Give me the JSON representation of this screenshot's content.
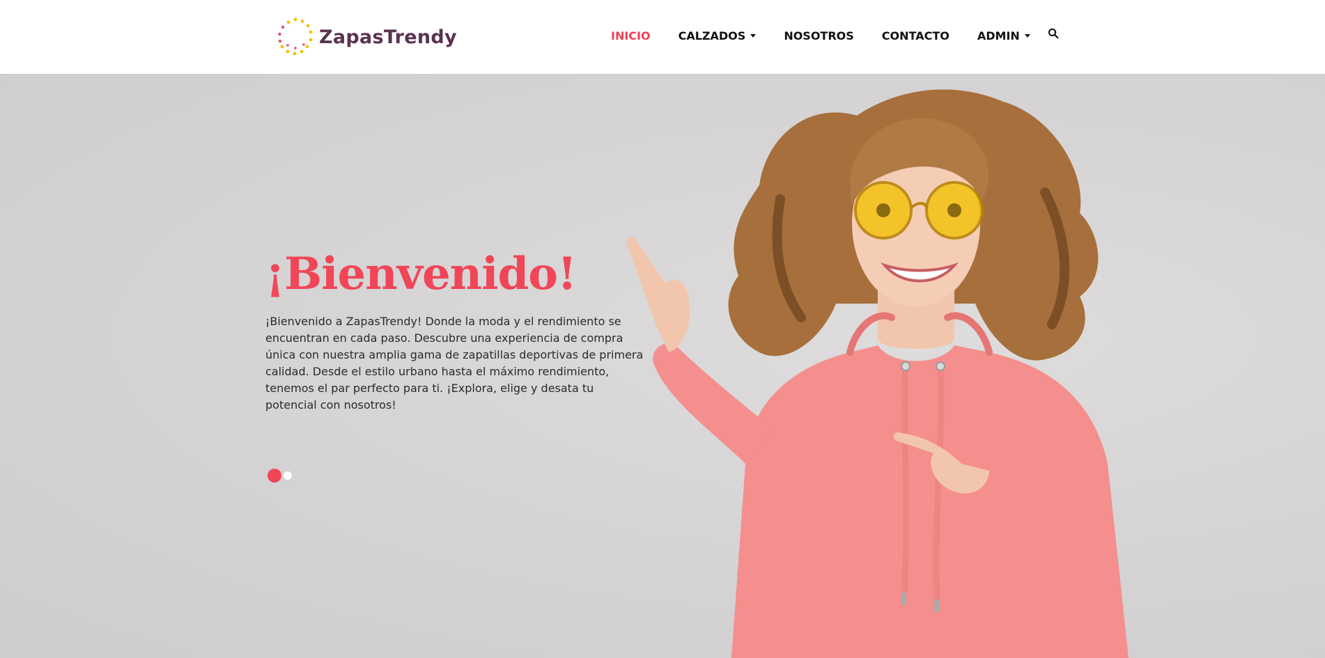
{
  "brand": {
    "name": "ZapasTrendy",
    "colors": {
      "accent": "#f04658",
      "logo_text": "#5a3350",
      "logo_dots": "#f4c20d"
    }
  },
  "nav": {
    "items": [
      {
        "label": "INICIO",
        "active": true
      },
      {
        "label": "CALZADOS",
        "dropdown": true
      },
      {
        "label": "NOSOTROS"
      },
      {
        "label": "CONTACTO"
      },
      {
        "label": "ADMIN",
        "dropdown": true
      }
    ],
    "search_icon": "search-icon"
  },
  "hero": {
    "title": "¡Bienvenido!",
    "text": "¡Bienvenido a ZapasTrendy! Donde la moda y el rendimiento se encuentran en cada paso. Descubre una experiencia de compra única con nuestra amplia gama de zapatillas deportivas de primera calidad. Desde el estilo urbano hasta el máximo rendimiento, tenemos el par perfecto para ti. ¡Explora, elige y desata tu potencial con nosotros!",
    "image": "woman in pink hoodie and yellow sunglasses pointing",
    "carousel": {
      "slides": 2,
      "active_index": 0
    }
  }
}
